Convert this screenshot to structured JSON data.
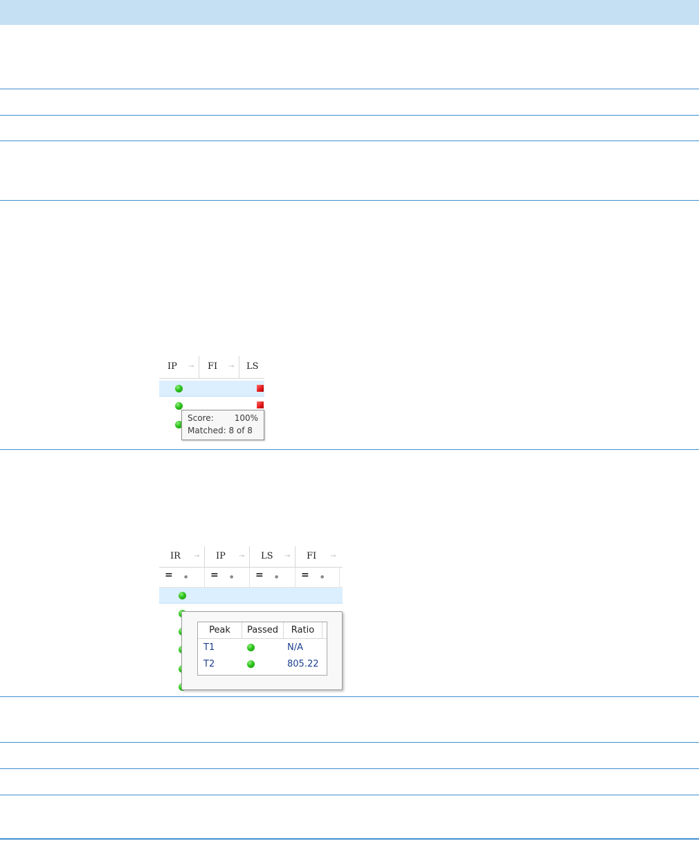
{
  "screenshot1": {
    "columns": [
      "IP",
      "FI",
      "LS"
    ],
    "tooltip": {
      "score_label": "Score:",
      "score_value": "100%",
      "matched_text": "Matched: 8 of 8"
    }
  },
  "screenshot2": {
    "columns": [
      "IR",
      "IP",
      "LS",
      "FI"
    ],
    "filter_symbol": "=",
    "tooltip": {
      "headers": [
        "Peak",
        "Passed",
        "Ratio"
      ],
      "rows": [
        {
          "peak": "T1",
          "ratio": "N/A"
        },
        {
          "peak": "T2",
          "ratio": "805.22"
        }
      ]
    }
  },
  "colors": {
    "header_band": "#c5dff3",
    "rule_line": "#3f8fd0",
    "selected_row": "#dcefff",
    "pass_dot": "#2dc21c",
    "fail_square": "#e01818"
  }
}
